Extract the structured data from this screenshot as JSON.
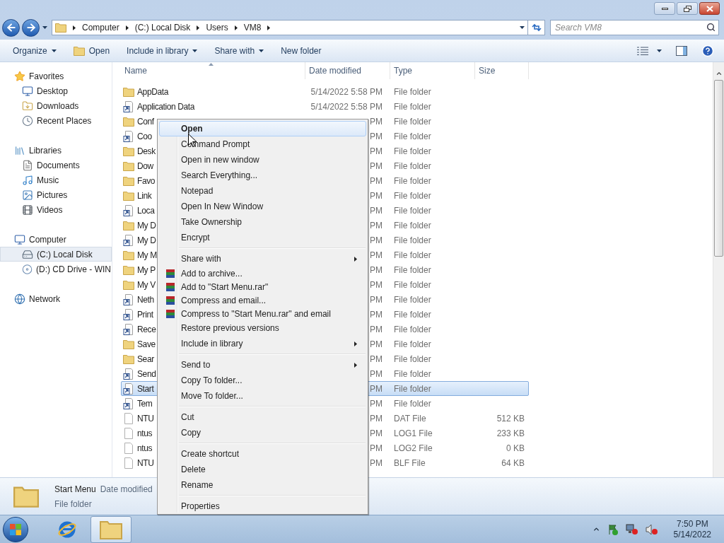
{
  "address_bar": {
    "breadcrumbs": [
      "Computer",
      "(C:) Local Disk",
      "Users",
      "VM8"
    ]
  },
  "search": {
    "placeholder": "Search VM8"
  },
  "toolbar": {
    "items": [
      {
        "kind": "dropdown",
        "label": "Organize"
      },
      {
        "kind": "icon_action",
        "label": "Open"
      },
      {
        "kind": "dropdown",
        "label": "Include in library"
      },
      {
        "kind": "dropdown",
        "label": "Share with"
      },
      {
        "kind": "action",
        "label": "New folder"
      }
    ]
  },
  "navigation": {
    "groups": [
      {
        "kind": "favorites",
        "label": "Favorites",
        "selected": false,
        "children": [
          {
            "kind": "desktop",
            "label": "Desktop",
            "selected": false
          },
          {
            "kind": "downloads",
            "label": "Downloads",
            "selected": false
          },
          {
            "kind": "recent",
            "label": "Recent Places",
            "selected": false
          }
        ]
      },
      {
        "kind": "libraries",
        "label": "Libraries",
        "selected": false,
        "children": [
          {
            "kind": "documents",
            "label": "Documents",
            "selected": false
          },
          {
            "kind": "music",
            "label": "Music",
            "selected": false
          },
          {
            "kind": "pictures",
            "label": "Pictures",
            "selected": false
          },
          {
            "kind": "videos",
            "label": "Videos",
            "selected": false
          }
        ]
      },
      {
        "kind": "computer",
        "label": "Computer",
        "selected": false,
        "children": [
          {
            "kind": "drive",
            "label": "(C:) Local Disk",
            "selected": true
          },
          {
            "kind": "cd",
            "label": "(D:) CD Drive - WIN",
            "selected": false
          }
        ]
      },
      {
        "kind": "network",
        "label": "Network",
        "selected": false
      }
    ]
  },
  "file_list": {
    "columns": [
      "Name",
      "Date modified",
      "Type",
      "Size"
    ],
    "rows": [
      {
        "kind": "folder",
        "name": "AppData",
        "date": "5/14/2022 5:58 PM",
        "type": "File folder",
        "selected": false
      },
      {
        "kind": "shortcut",
        "name": "Application Data",
        "date": "5/14/2022 5:58 PM",
        "type": "File folder",
        "selected": false
      },
      {
        "kind": "folder",
        "name": "Conf",
        "date": "PM",
        "type": "File folder",
        "selected": false
      },
      {
        "kind": "shortcut",
        "name": "Coo",
        "date": "PM",
        "type": "File folder",
        "selected": false
      },
      {
        "kind": "folder",
        "name": "Desk",
        "date": "PM",
        "type": "File folder",
        "selected": false
      },
      {
        "kind": "folder",
        "name": "Dow",
        "date": "PM",
        "type": "File folder",
        "selected": false
      },
      {
        "kind": "folder",
        "name": "Favo",
        "date": "PM",
        "type": "File folder",
        "selected": false
      },
      {
        "kind": "folder",
        "name": "Link",
        "date": "PM",
        "type": "File folder",
        "selected": false
      },
      {
        "kind": "shortcut",
        "name": "Loca",
        "date": "PM",
        "type": "File folder",
        "selected": false
      },
      {
        "kind": "folder",
        "name": "My D",
        "date": "PM",
        "type": "File folder",
        "selected": false
      },
      {
        "kind": "shortcut",
        "name": "My D",
        "date": "PM",
        "type": "File folder",
        "selected": false
      },
      {
        "kind": "folder",
        "name": "My M",
        "date": "PM",
        "type": "File folder",
        "selected": false
      },
      {
        "kind": "folder",
        "name": "My P",
        "date": "PM",
        "type": "File folder",
        "selected": false
      },
      {
        "kind": "folder",
        "name": "My V",
        "date": "PM",
        "type": "File folder",
        "selected": false
      },
      {
        "kind": "shortcut",
        "name": "Neth",
        "date": "PM",
        "type": "File folder",
        "selected": false
      },
      {
        "kind": "shortcut",
        "name": "Print",
        "date": "PM",
        "type": "File folder",
        "selected": false
      },
      {
        "kind": "shortcut",
        "name": "Rece",
        "date": "PM",
        "type": "File folder",
        "selected": false
      },
      {
        "kind": "folder",
        "name": "Save",
        "date": "PM",
        "type": "File folder",
        "selected": false
      },
      {
        "kind": "folder",
        "name": "Sear",
        "date": "PM",
        "type": "File folder",
        "selected": false
      },
      {
        "kind": "shortcut",
        "name": "Send",
        "date": "PM",
        "type": "File folder",
        "selected": false
      },
      {
        "kind": "shortcut",
        "name": "Start",
        "date": "PM",
        "type": "File folder",
        "selected": true
      },
      {
        "kind": "shortcut",
        "name": "Tem",
        "date": "PM",
        "type": "File folder",
        "selected": false
      },
      {
        "kind": "file",
        "name": "NTU",
        "date": "PM",
        "type": "DAT File",
        "size": "512 KB",
        "selected": false
      },
      {
        "kind": "file",
        "name": "ntus",
        "date": "PM",
        "type": "LOG1 File",
        "size": "233 KB",
        "selected": false
      },
      {
        "kind": "file",
        "name": "ntus",
        "date": "PM",
        "type": "LOG2 File",
        "size": "0 KB",
        "selected": false
      },
      {
        "kind": "file",
        "name": "NTU",
        "date": "PM",
        "type": "BLF File",
        "size": "64 KB",
        "selected": false
      }
    ]
  },
  "context_menu": {
    "items": [
      {
        "kind": "command",
        "label": "Open",
        "selected": true
      },
      {
        "kind": "command",
        "label": "Command Prompt",
        "selected": false
      },
      {
        "kind": "command",
        "label": "Open in new window",
        "selected": false
      },
      {
        "kind": "command",
        "label": "Search Everything...",
        "selected": false
      },
      {
        "kind": "command",
        "label": "Notepad",
        "selected": false
      },
      {
        "kind": "command",
        "label": "Open In New Window",
        "selected": false
      },
      {
        "kind": "command",
        "label": "Take Ownership",
        "selected": false
      },
      {
        "kind": "command",
        "label": "Encrypt",
        "selected": false
      },
      {
        "kind": "separator"
      },
      {
        "kind": "submenu",
        "label": "Share with",
        "selected": false
      },
      {
        "kind": "archive",
        "label": "Add to archive...",
        "selected": false
      },
      {
        "kind": "archive",
        "label": "Add to \"Start Menu.rar\"",
        "selected": false
      },
      {
        "kind": "archive",
        "label": "Compress and email...",
        "selected": false
      },
      {
        "kind": "archive",
        "label": "Compress to \"Start Menu.rar\" and email",
        "selected": false
      },
      {
        "kind": "command",
        "label": "Restore previous versions",
        "selected": false
      },
      {
        "kind": "submenu",
        "label": "Include in library",
        "selected": false
      },
      {
        "kind": "separator"
      },
      {
        "kind": "submenu",
        "label": "Send to",
        "selected": false
      },
      {
        "kind": "command",
        "label": "Copy To folder...",
        "selected": false
      },
      {
        "kind": "command",
        "label": "Move To folder...",
        "selected": false
      },
      {
        "kind": "separator"
      },
      {
        "kind": "command",
        "label": "Cut",
        "selected": false
      },
      {
        "kind": "command",
        "label": "Copy",
        "selected": false
      },
      {
        "kind": "separator"
      },
      {
        "kind": "command",
        "label": "Create shortcut",
        "selected": false
      },
      {
        "kind": "command",
        "label": "Delete",
        "selected": false
      },
      {
        "kind": "command",
        "label": "Rename",
        "selected": false
      },
      {
        "kind": "separator"
      },
      {
        "kind": "command",
        "label": "Properties",
        "selected": false
      }
    ]
  },
  "details_pane": {
    "name": "Start Menu",
    "date_label": "Date modified",
    "type": "File folder"
  },
  "taskbar": {
    "apps": [
      {
        "kind": "browser",
        "active": false
      },
      {
        "kind": "explorer",
        "active": true
      }
    ]
  },
  "clock": {
    "time": "7:50 PM",
    "date": "5/14/2022"
  }
}
